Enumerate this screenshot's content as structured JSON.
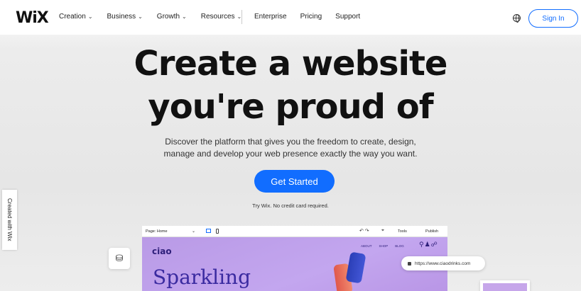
{
  "nav": {
    "logo": "WiX",
    "menu": [
      {
        "label": "Creation"
      },
      {
        "label": "Business"
      },
      {
        "label": "Growth"
      },
      {
        "label": "Resources"
      }
    ],
    "links": [
      "Enterprise",
      "Pricing",
      "Support"
    ],
    "sign_in": "Sign In"
  },
  "hero": {
    "title_line1": "Create a website",
    "title_line2": "you're proud of",
    "sub_line1": "Discover the platform that gives you the freedom to create, design,",
    "sub_line2": "manage and develop your web presence exactly the way you want.",
    "cta": "Get Started",
    "note": "Try Wix. No credit card required."
  },
  "side_tab": "Created with Wix",
  "editor": {
    "page_label": "Page: Home",
    "tools_label": "Tools",
    "publish_label": "Publish",
    "site_logo": "ciao",
    "site_nav": [
      "ABOUT",
      "SHOP",
      "BLOG"
    ],
    "headline": "Sparkling",
    "url": "https://www.ciaodrinks.com"
  },
  "colors": {
    "accent": "#116dff",
    "preview_bg": "#c3a6ef"
  }
}
